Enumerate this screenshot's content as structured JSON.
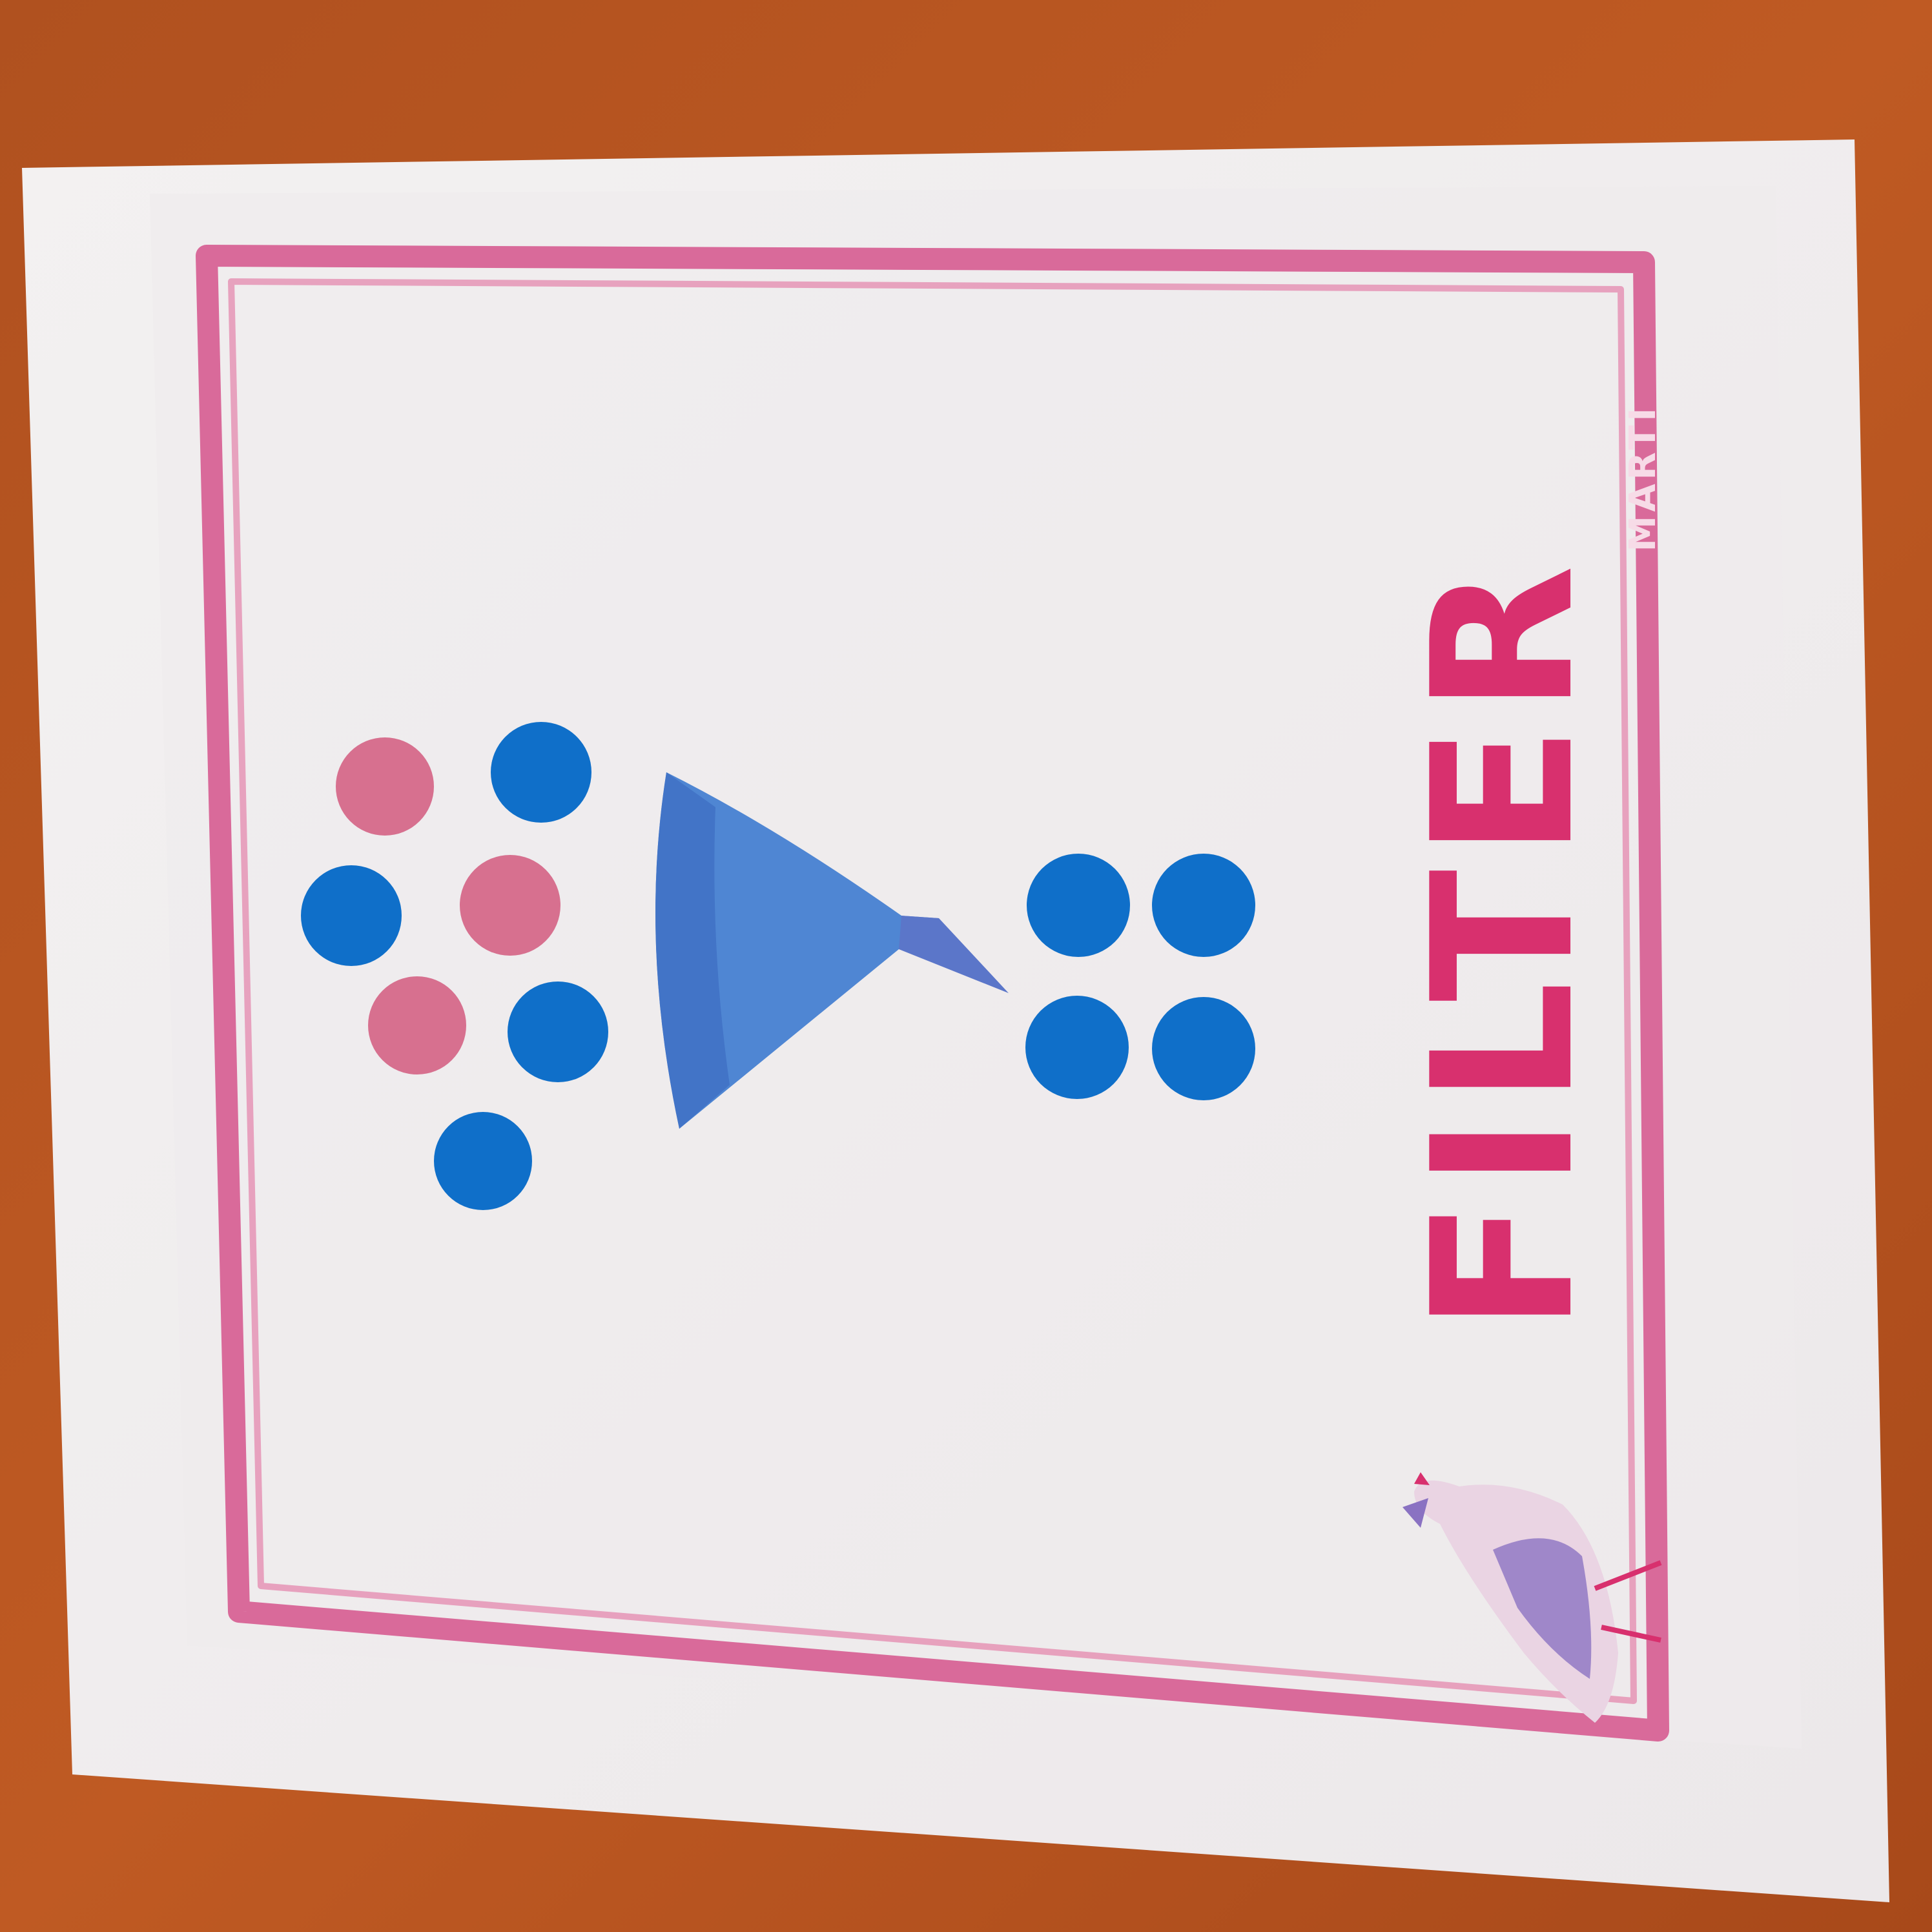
{
  "card": {
    "title": "FILTER",
    "watermark": "MARTI"
  },
  "colors": {
    "background": "#b5541f",
    "paper": "#f2efef",
    "border": "#d96a9a",
    "text": "#d8306e",
    "dot_blue": "#0f6fc9",
    "dot_pink": "#d7708f",
    "funnel": "#4f86d3",
    "funnel_shade": "#3f71c4",
    "bird_body": "#ead4e3",
    "bird_wing": "#9f87c9"
  },
  "icons": {
    "funnel": "funnel-icon",
    "bird": "bird-icon"
  },
  "dots": {
    "input_blue_count": 4,
    "input_pink_count": 3,
    "output_blue_count": 4
  }
}
